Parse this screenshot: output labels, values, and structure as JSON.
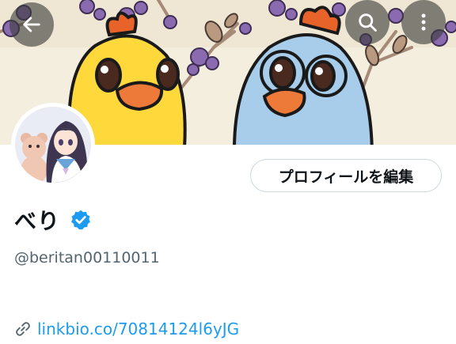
{
  "header": {
    "icons": {
      "back": "arrow-left-icon",
      "search": "search-icon",
      "more": "more-vertical-icon"
    }
  },
  "banner": {
    "description_icon": "duck-illustration"
  },
  "profile": {
    "display_name": "べり",
    "handle": "@beritan00110011",
    "edit_button_label": "プロフィールを編集",
    "verified": true,
    "link": "linkbio.co/70814124l6yJG",
    "link_icon": "link-icon"
  },
  "colors": {
    "accent": "#1d9bf0",
    "secondary_text": "#536471",
    "border": "#cfd9de",
    "yellow_duck": "#ffd93b",
    "blue_duck": "#a8cdea",
    "beak": "#ee7a3a"
  }
}
